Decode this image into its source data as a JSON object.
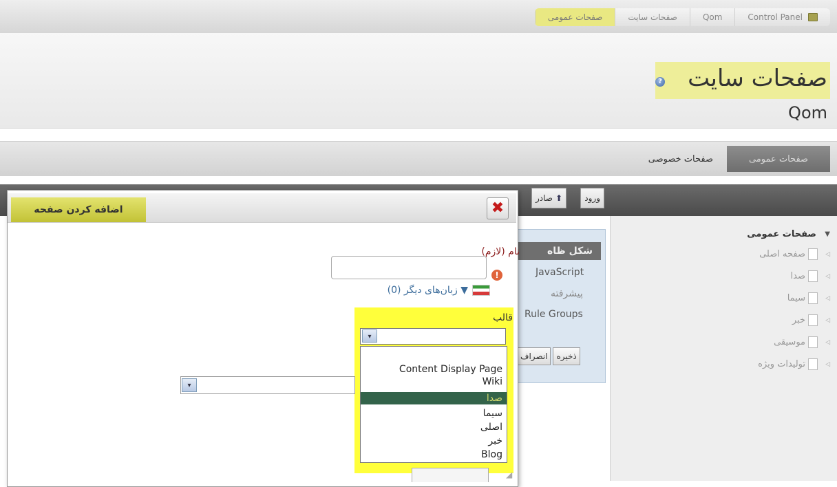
{
  "breadcrumb": {
    "items": [
      "Control Panel",
      "Qom",
      "صفحات سایت",
      "صفحات عمومی"
    ],
    "active_highlight": "#e9e882"
  },
  "header": {
    "title": "صفحات سایت",
    "site_name": "Qom",
    "help_glyph": "?"
  },
  "tabs": {
    "public_label": "صفحات عمومی",
    "private_label": "صفحات خصوصی"
  },
  "tree": {
    "root_label": "صفحات عمومی",
    "items": [
      "صفحه اصلی",
      "صدا",
      "سیما",
      "خبر",
      "موسیقی",
      "تولیدات ویژه"
    ]
  },
  "middle": {
    "import_label": "ورود",
    "export_label": "صادر",
    "tab_label": "شکل ظاه",
    "links": [
      "JavaScript",
      "پیشرفته",
      "Rule Groups"
    ],
    "save_label": "ذخیره",
    "cancel_label": "انصراف"
  },
  "dialog": {
    "title": "اضافه کردن صفحه",
    "close_glyph": "✖",
    "name_label": "نام (لازم)",
    "required_glyph": "!",
    "languages_label": "▼ زبان‌های دیگر (0)",
    "template_label": "قالب",
    "template_selected_index": 2,
    "template_options": [
      "Content Display Page",
      "Wiki",
      "صدا",
      "سیما",
      "اصلی",
      "خبر",
      "Blog"
    ],
    "select_arrow_glyph": "▾"
  },
  "colors": {
    "highlight_yellow": "#ffff3b",
    "selected_option_bg": "#33634a",
    "title_yellow": "#d6d64f"
  }
}
